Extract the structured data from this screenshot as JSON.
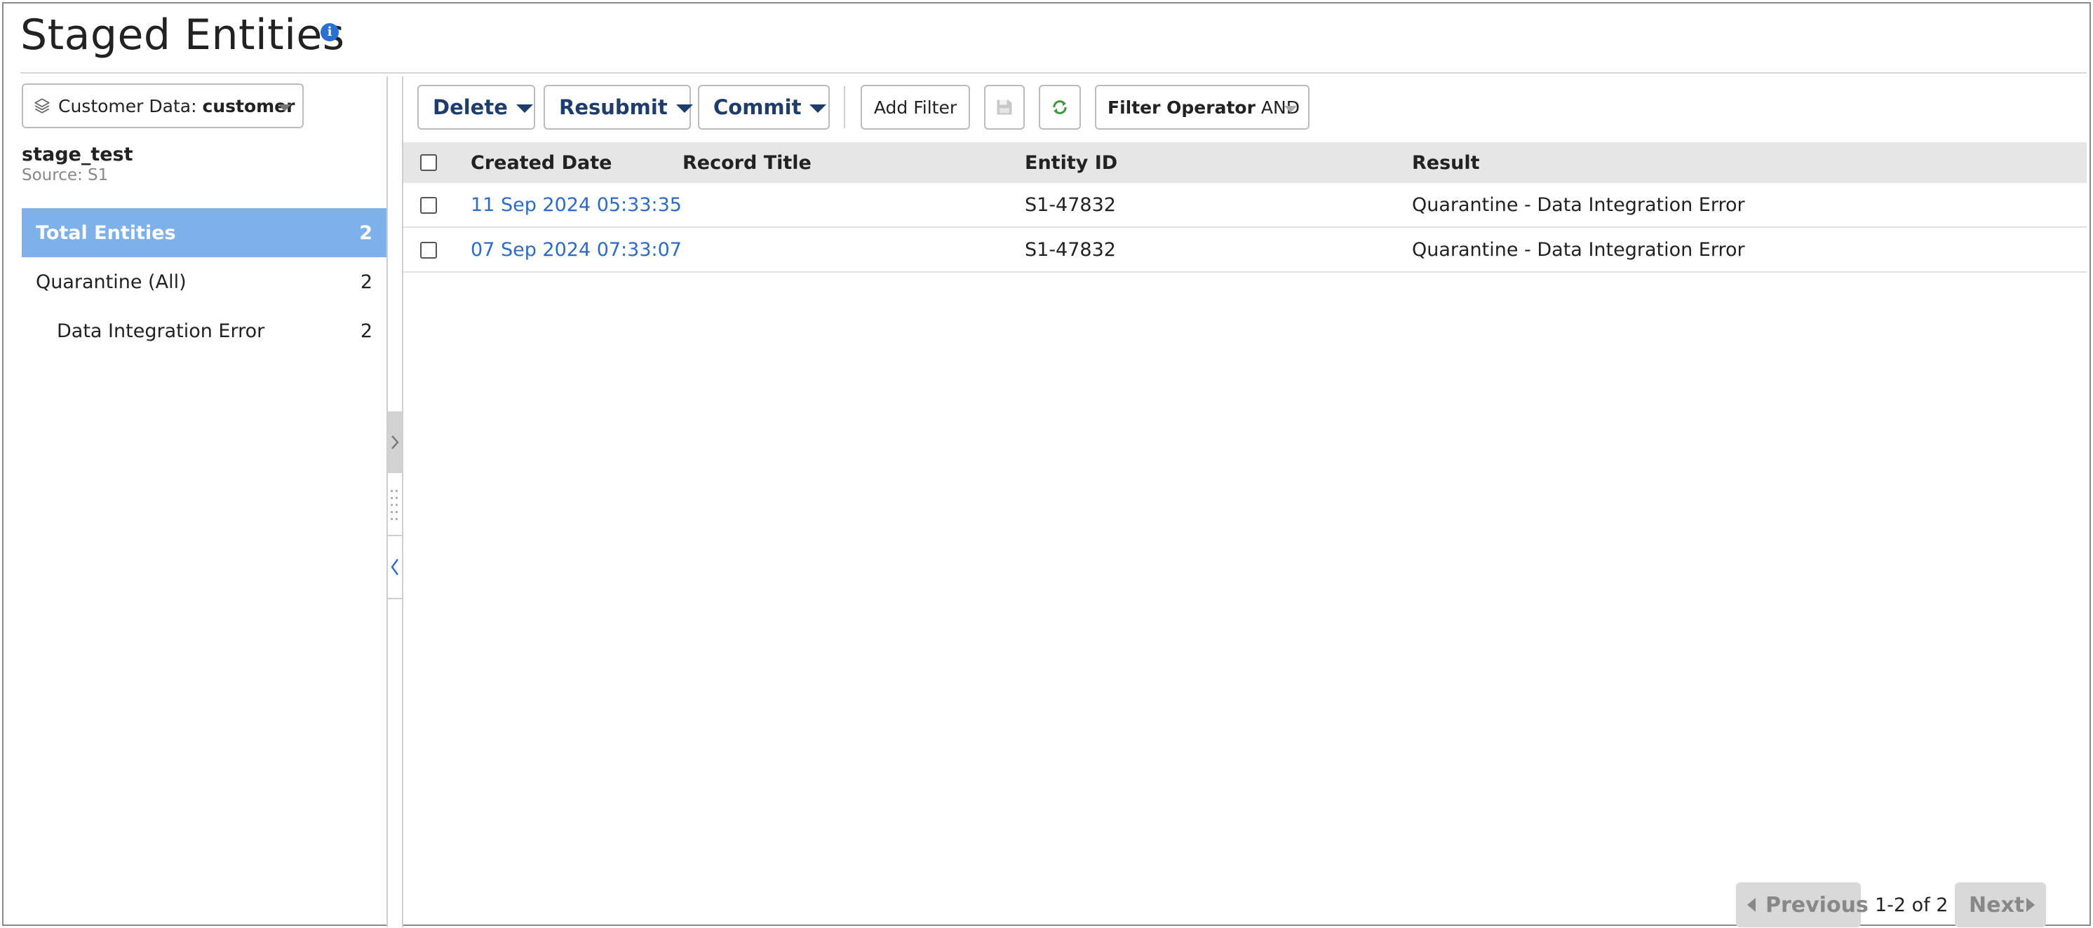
{
  "page": {
    "title": "Staged Entities",
    "info_icon": "info-icon"
  },
  "sidebar": {
    "dataset_select": {
      "prefix": "Customer Data:",
      "value": "customer",
      "icon": "layers-icon"
    },
    "stage": {
      "name": "stage_test",
      "source": "Source: S1"
    },
    "items": [
      {
        "label": "Total Entities",
        "count": "2",
        "active": true
      },
      {
        "label": "Quarantine (All)",
        "count": "2",
        "active": false
      },
      {
        "label": "Data Integration Error",
        "count": "2",
        "active": false
      }
    ]
  },
  "toolbar": {
    "delete_label": "Delete",
    "resubmit_label": "Resubmit",
    "commit_label": "Commit",
    "add_filter_label": "Add Filter",
    "save_icon": "save-icon",
    "refresh_icon": "refresh-icon",
    "filter_operator_label": "Filter Operator",
    "filter_operator_value": "AND"
  },
  "grid": {
    "columns": [
      "Created Date",
      "Record Title",
      "Entity ID",
      "Result"
    ],
    "rows": [
      {
        "created_date": "11 Sep 2024 05:33:35",
        "record_title": "",
        "entity_id": "S1-47832",
        "result": "Quarantine - Data Integration Error"
      },
      {
        "created_date": "07 Sep 2024 07:33:07",
        "record_title": "",
        "entity_id": "S1-47832",
        "result": "Quarantine - Data Integration Error"
      }
    ]
  },
  "pagination": {
    "previous_label": "Previous",
    "next_label": "Next",
    "range_text": "1-2 of 2"
  },
  "colors": {
    "accent_active": "#7eb0ea",
    "link": "#2a6cc7",
    "toolbar_text": "#1f3d6b",
    "info_blue": "#2a6fd6",
    "refresh_green": "#3a9a3a"
  }
}
